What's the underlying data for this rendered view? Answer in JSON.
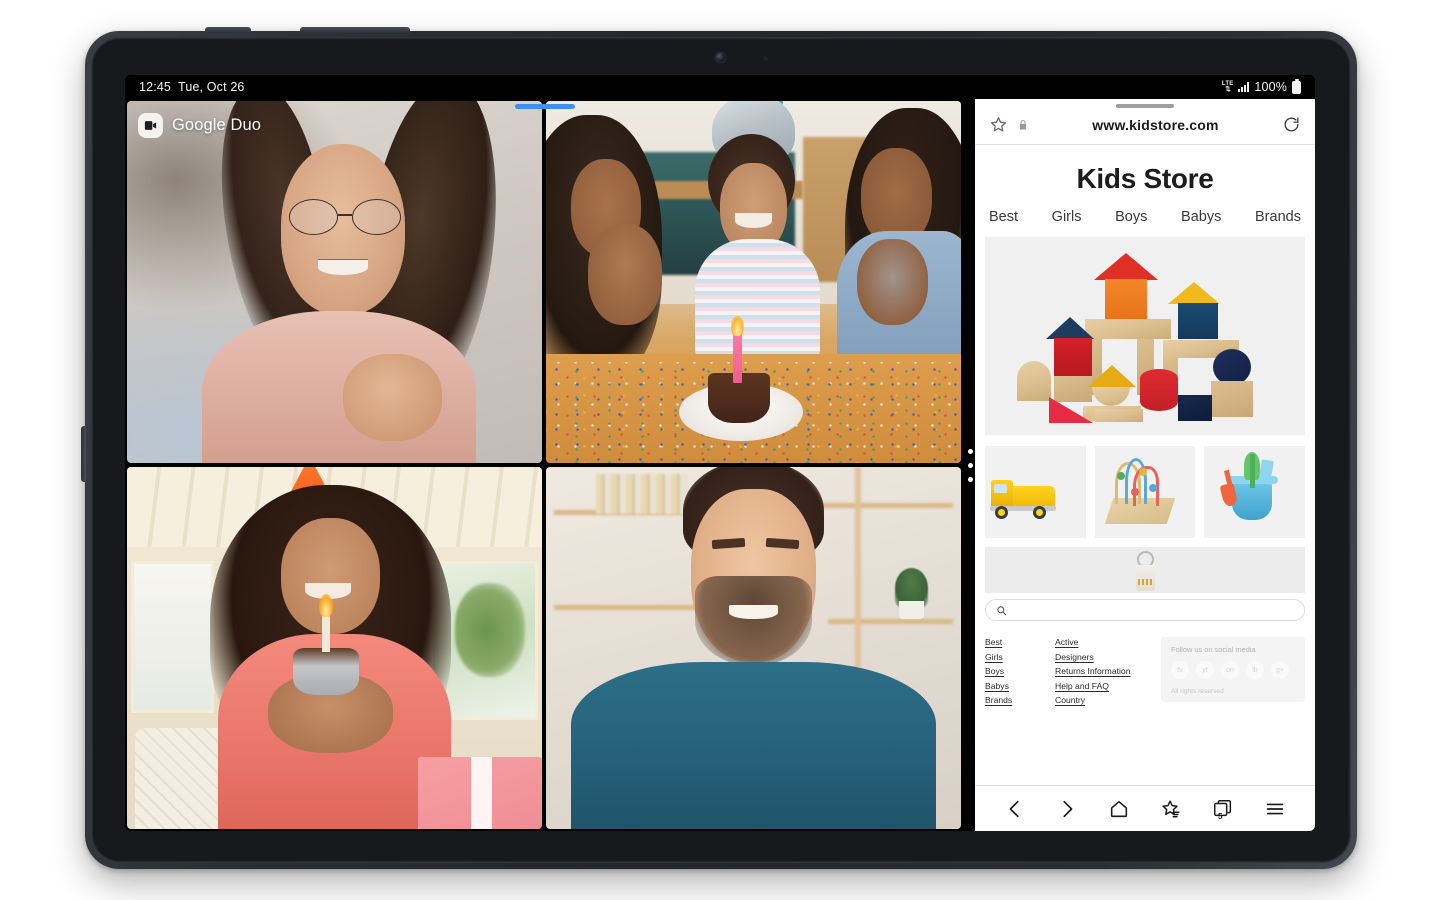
{
  "status_bar": {
    "time": "12:45",
    "date": "Tue, Oct 26",
    "network_label": "LTE",
    "network_arrows": "⇅",
    "battery_percent": "100%"
  },
  "duo": {
    "app_name": "Google Duo",
    "app_icon": "video-camera-icon",
    "tiles": [
      {
        "id": "tile-1",
        "description": "Woman with round glasses in pink sweater smiling"
      },
      {
        "id": "tile-2",
        "description": "Family celebrating birthday with cupcake and confetti"
      },
      {
        "id": "tile-3",
        "description": "Woman in orange party hat holding cupcake with lit candle"
      },
      {
        "id": "tile-4",
        "description": "Bearded man in teal shirt smiling"
      }
    ]
  },
  "browser": {
    "address_bar": {
      "bookmark_icon": "star-icon",
      "lock_icon": "lock-icon",
      "url": "www.kidstore.com",
      "reload_icon": "reload-icon"
    },
    "page": {
      "title": "Kids Store",
      "nav": [
        {
          "label": "Best"
        },
        {
          "label": "Girls"
        },
        {
          "label": "Boys"
        },
        {
          "label": "Babys"
        },
        {
          "label": "Brands"
        }
      ],
      "hero": {
        "alt": "Colorful wooden building blocks"
      },
      "thumbnails": [
        {
          "alt": "Yellow toy dump truck"
        },
        {
          "alt": "Wooden bead maze toy"
        },
        {
          "alt": "Blue beach bucket with shovels"
        }
      ],
      "strip": {
        "alt": "Hanging product tag"
      },
      "search": {
        "placeholder": "",
        "value": "",
        "icon": "search-icon"
      },
      "footer": {
        "col1": [
          {
            "label": "Best"
          },
          {
            "label": "Girls"
          },
          {
            "label": "Boys"
          },
          {
            "label": "Babys"
          },
          {
            "label": "Brands"
          }
        ],
        "col2": [
          {
            "label": "Active"
          },
          {
            "label": "Designers"
          },
          {
            "label": "Returns Information"
          },
          {
            "label": "Help and FAQ"
          },
          {
            "label": "Country"
          }
        ],
        "social_heading": "Follow us on social media",
        "social_icons": [
          {
            "label": "tv"
          },
          {
            "label": "yt"
          },
          {
            "label": "on"
          },
          {
            "label": "lb"
          },
          {
            "label": "g+"
          }
        ],
        "rights": "All rights reserved"
      }
    },
    "bottom_bar": [
      {
        "name": "back-icon",
        "label": "Back"
      },
      {
        "name": "forward-icon",
        "label": "Forward"
      },
      {
        "name": "home-icon",
        "label": "Home"
      },
      {
        "name": "bookmarks-icon",
        "label": "Bookmarks"
      },
      {
        "name": "tabs-icon",
        "label": "Tabs",
        "count": "5"
      },
      {
        "name": "menu-icon",
        "label": "Menu"
      }
    ]
  },
  "colors": {
    "accent_blue": "#3d8ff0",
    "status_bar_bg": "#000000",
    "page_bg": "#ffffff",
    "frame": "#2b2e33"
  }
}
